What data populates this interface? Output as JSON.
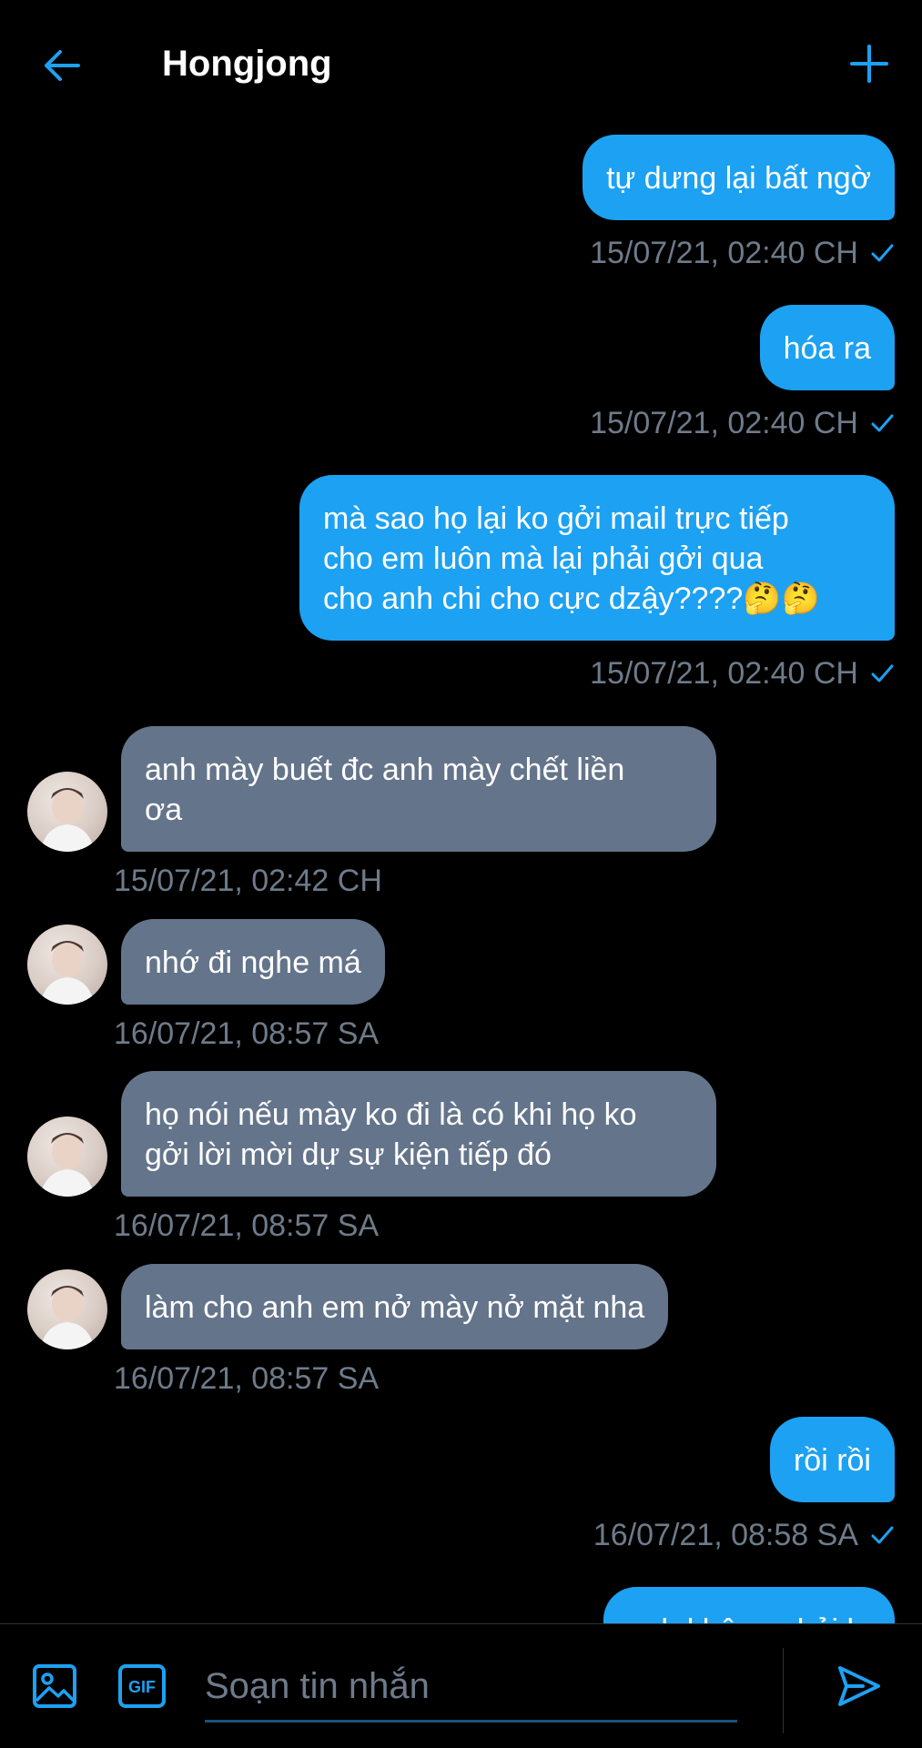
{
  "header": {
    "title": "Hongjong",
    "back_icon": "arrow-left-icon",
    "add_icon": "plus-icon"
  },
  "colors": {
    "accent": "#1da1f2",
    "incoming_bubble": "#64748a",
    "timestamp": "#6e7b8a",
    "background": "#000000"
  },
  "messages": [
    {
      "direction": "out",
      "text": "tự dưng lại bất ngờ",
      "time": "15/07/21, 02:40 CH",
      "read": true
    },
    {
      "direction": "out",
      "text": "hóa ra",
      "time": "15/07/21, 02:40 CH",
      "read": true
    },
    {
      "direction": "out",
      "text": "mà sao họ lại ko gởi mail trực tiếp\ncho em luôn mà lại phải gởi qua\ncho anh chi cho cực dzậy????🤔🤔",
      "time": "15/07/21, 02:40 CH",
      "read": true
    },
    {
      "direction": "in",
      "text": "anh mày buết đc anh mày chết liền\nơa",
      "time": "15/07/21, 02:42 CH"
    },
    {
      "direction": "in",
      "text": "nhớ đi nghe má",
      "time": "16/07/21, 08:57 SA"
    },
    {
      "direction": "in",
      "text": "họ nói nếu mày ko đi là có khi họ ko\ngởi lời mời dự sự kiện tiếp đó",
      "time": "16/07/21, 08:57 SA"
    },
    {
      "direction": "in",
      "text": "làm cho anh em nở mày nở mặt nha",
      "time": "16/07/21, 08:57 SA"
    },
    {
      "direction": "out",
      "text": "rồi rồi",
      "time": "16/07/21, 08:58 SA",
      "read": true
    },
    {
      "direction": "out",
      "text": "anh không phải lo",
      "time": "",
      "read": false
    }
  ],
  "composer": {
    "placeholder": "Soạn tin nhắn",
    "image_icon": "image-icon",
    "gif_icon": "gif-icon",
    "gif_label": "GIF",
    "send_icon": "send-icon"
  }
}
